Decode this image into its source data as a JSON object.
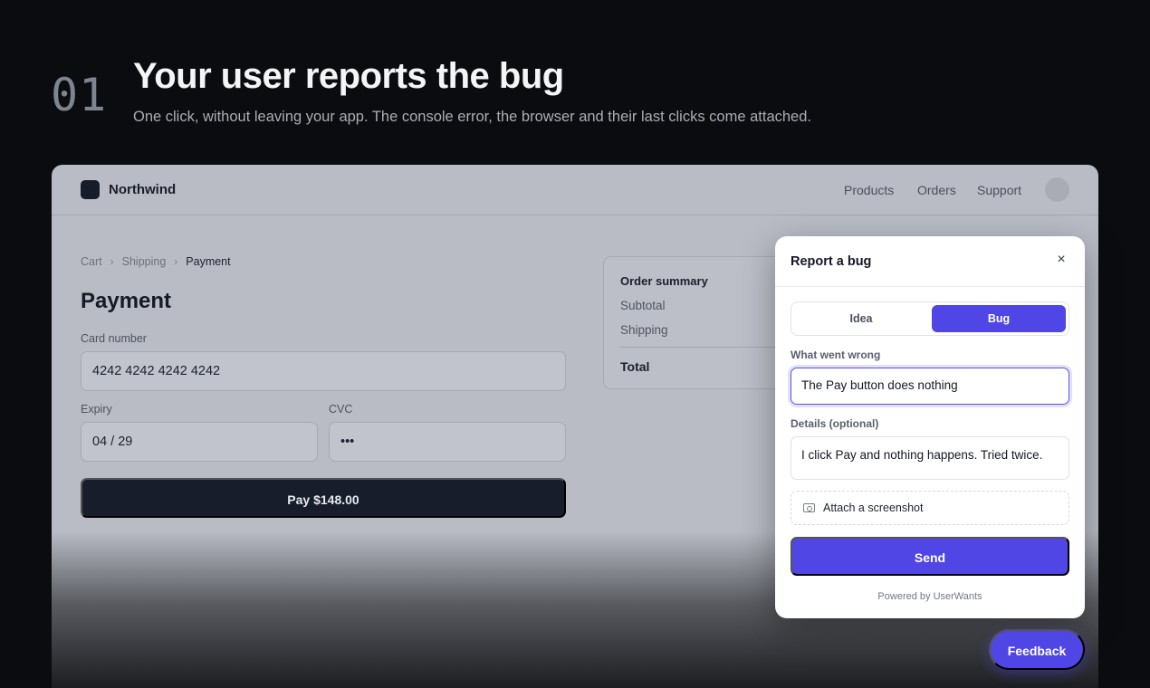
{
  "hero": {
    "step": "01",
    "title": "Your user reports the bug",
    "subtitle": "One click, without leaving your app. The console error, the browser and their last clicks come attached."
  },
  "app": {
    "brand": "Northwind",
    "nav": [
      "Products",
      "Orders",
      "Support"
    ],
    "breadcrumb": [
      "Cart",
      "Shipping",
      "Payment"
    ],
    "breadcrumb_sep": "›",
    "page_title": "Payment",
    "card_label": "Card number",
    "card_value": "4242 4242 4242 4242",
    "expiry_label": "Expiry",
    "expiry_value": "04 / 29",
    "cvc_label": "CVC",
    "cvc_value": "•••",
    "pay_button": "Pay $148.00",
    "summary": {
      "title": "Order summary",
      "subtotal": "Subtotal",
      "shipping": "Shipping",
      "total": "Total"
    }
  },
  "widget": {
    "title": "Report a bug",
    "close": "×",
    "tabs": {
      "idea": "Idea",
      "bug": "Bug",
      "selected": "Bug"
    },
    "what_label": "What went wrong",
    "what_value": "The Pay button does nothing",
    "details_label": "Details (optional)",
    "details_value": "I click Pay and nothing happens. Tried twice.",
    "attach": "Attach a screenshot",
    "send": "Send",
    "powered": "Powered by UserWants"
  },
  "feedback_button": "Feedback",
  "colors": {
    "accent": "#4f46e5",
    "background": "#0b0c0f",
    "app_surface": "#b9bcc5",
    "primary_dark": "#181d2c"
  },
  "icons": {
    "close": "close-icon",
    "attach": "camera-icon"
  }
}
